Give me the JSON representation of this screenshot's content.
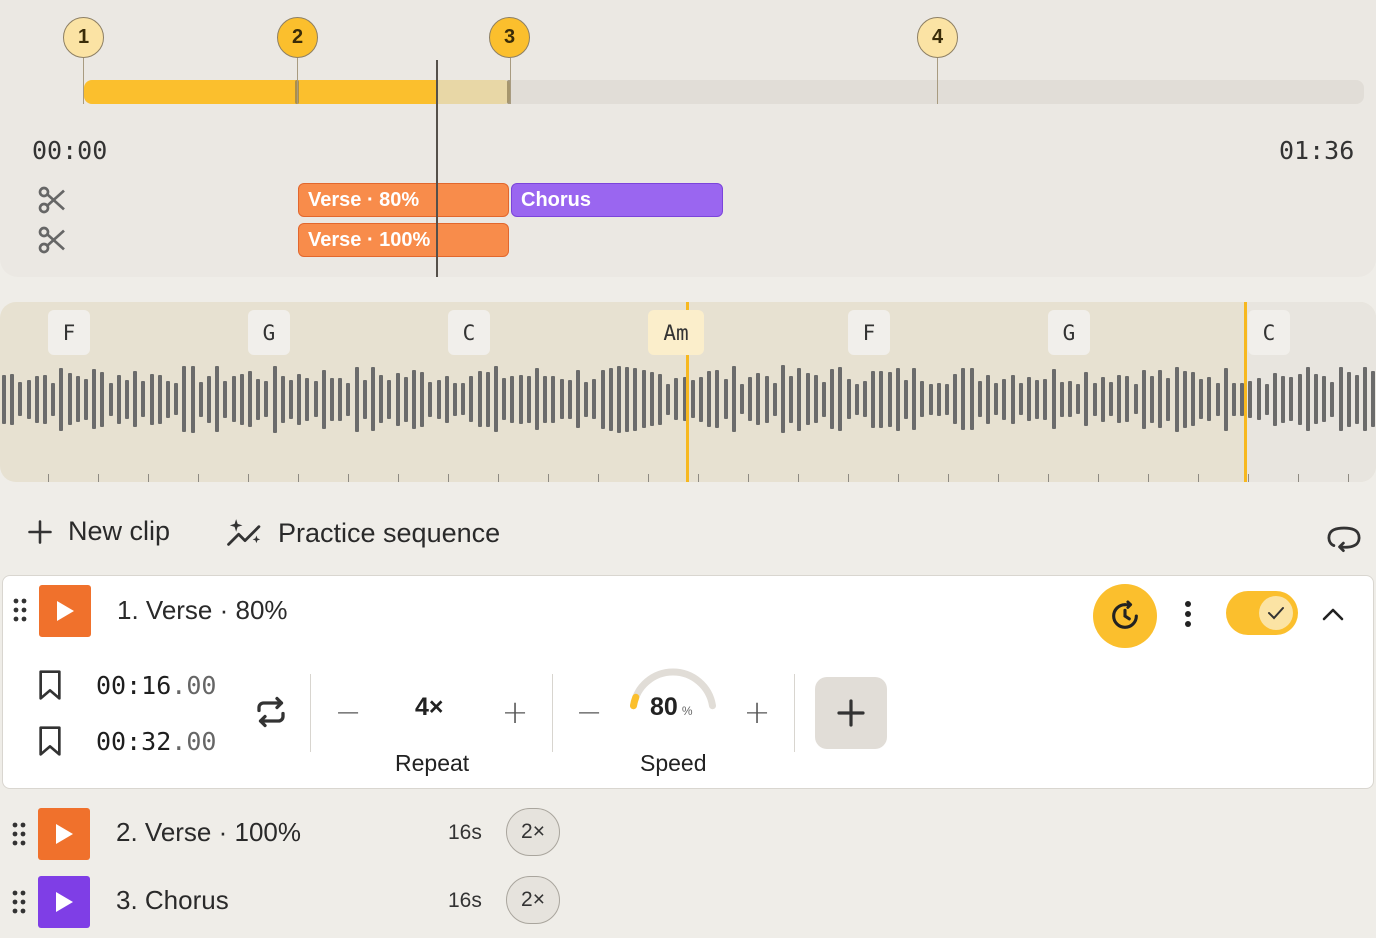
{
  "timeline": {
    "markers": [
      "1",
      "2",
      "3",
      "4"
    ],
    "start_time": "00:00",
    "end_time": "01:36",
    "clip_tags": [
      "Verse · 80%",
      "Chorus",
      "Verse · 100%"
    ],
    "colors": {
      "played": "#fbbf2d",
      "verse": "#f88c4b",
      "chorus": "#9a66f0"
    }
  },
  "waveform": {
    "chords": [
      "F",
      "G",
      "C",
      "Am",
      "F",
      "G",
      "C"
    ],
    "active_chord": "Am"
  },
  "toolbar": {
    "new_clip_label": "New clip",
    "practice_label": "Practice sequence"
  },
  "clips": [
    {
      "title": "1. Verse · 80%",
      "start_main": "00:16",
      "start_frac": ".00",
      "end_main": "00:32",
      "end_frac": ".00",
      "repeat_value": "4×",
      "repeat_label": "Repeat",
      "speed_value": "80",
      "speed_unit": "%",
      "speed_label": "Speed",
      "speed_percent": 80,
      "enabled": true
    },
    {
      "title": "2. Verse · 100%",
      "duration": "16s",
      "repeat": "2×"
    },
    {
      "title": "3. Chorus",
      "duration": "16s",
      "repeat": "2×"
    }
  ],
  "icons": {
    "scissors": "scissors-icon",
    "add": "plus-icon",
    "sparkle": "sparkle-icon",
    "loop": "loop-icon",
    "bookmark": "bookmark-icon",
    "repeat": "repeat-icon",
    "timer": "timer-icon",
    "more": "more-icon",
    "collapse": "chevron-up-icon"
  }
}
